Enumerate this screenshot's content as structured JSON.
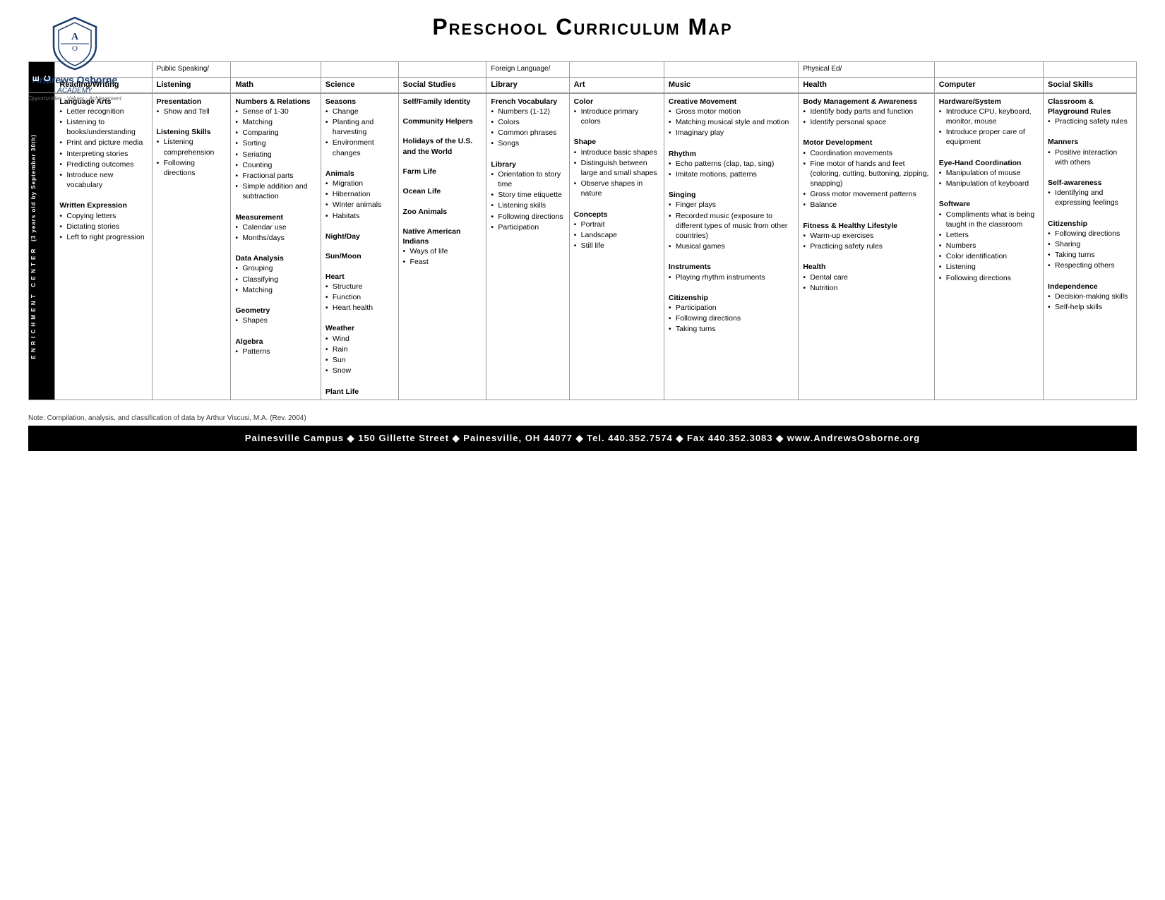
{
  "header": {
    "title": "Preschool Curriculum Map",
    "logo": {
      "school_name_line1": "Andrews Osborne",
      "school_name_line2": "ACADEMY",
      "tagline": "Opportunities · Values · Achievement"
    }
  },
  "table": {
    "ec_label": "E\nC",
    "section_label": "3 years old by September 30th",
    "enrichment_label": "ENRICHMENT CENTER",
    "columns": [
      {
        "super_header": "",
        "header": "Reading/Writing",
        "content_title": "Language Arts",
        "items": [
          "Letter recognition",
          "Listening to books/understanding",
          "Print and picture media",
          "Interpreting stories",
          "Predicting outcomes",
          "Introduce new vocabulary"
        ],
        "sections": [
          {
            "title": "Written Expression",
            "items": [
              "Copying letters",
              "Dictating stories",
              "Left to right progression"
            ]
          }
        ]
      },
      {
        "super_header": "Public Speaking/",
        "header": "Listening",
        "content_title": "Presentation",
        "items": [
          "Show and Tell"
        ],
        "sections": [
          {
            "title": "Listening Skills",
            "items": [
              "Listening comprehension",
              "Following directions"
            ]
          }
        ]
      },
      {
        "super_header": "",
        "header": "Math",
        "content_title": "Numbers & Relations",
        "items": [
          "Sense of 1-30",
          "Matching",
          "Comparing",
          "Sorting",
          "Seriating",
          "Counting",
          "Fractional parts",
          "Simple addition and subtraction"
        ],
        "sections": [
          {
            "title": "Measurement",
            "items": [
              "Calendar use",
              "Months/days"
            ]
          },
          {
            "title": "Data Analysis",
            "items": [
              "Grouping",
              "Classifying",
              "Matching"
            ]
          },
          {
            "title": "Geometry",
            "items": [
              "Shapes"
            ]
          },
          {
            "title": "Algebra",
            "items": [
              "Patterns"
            ]
          }
        ]
      },
      {
        "super_header": "",
        "header": "Science",
        "content_title": "Seasons",
        "items": [
          "Change",
          "Planting and harvesting",
          "Environment changes"
        ],
        "sections": [
          {
            "title": "Animals",
            "items": [
              "Migration",
              "Hibernation",
              "Winter animals",
              "Habitats"
            ]
          },
          {
            "title": "Night/Day",
            "items": []
          },
          {
            "title": "Sun/Moon",
            "items": []
          },
          {
            "title": "Heart",
            "items": [
              "Structure",
              "Function",
              "Heart health"
            ]
          },
          {
            "title": "Weather",
            "items": [
              "Wind",
              "Rain",
              "Sun",
              "Snow"
            ]
          },
          {
            "title": "Plant Life",
            "items": []
          }
        ]
      },
      {
        "super_header": "",
        "header": "Social Studies",
        "content_title": "Self/Family Identity",
        "items": [],
        "sections": [
          {
            "title": "Community Helpers",
            "items": []
          },
          {
            "title": "Holidays of the U.S. and the World",
            "items": []
          },
          {
            "title": "Farm Life",
            "items": []
          },
          {
            "title": "Ocean Life",
            "items": []
          },
          {
            "title": "Zoo Animals",
            "items": []
          },
          {
            "title": "Native American Indians",
            "items": [
              "Ways of life",
              "Feast"
            ]
          }
        ]
      },
      {
        "super_header": "Foreign Language/",
        "header": "Library",
        "content_title": "French Vocabulary",
        "items": [
          "Numbers (1-12)",
          "Colors",
          "Common phrases",
          "Songs"
        ],
        "sections": [
          {
            "title": "Library",
            "items": [
              "Orientation to story time",
              "Story time etiquette",
              "Listening skills",
              "Following directions",
              "Participation"
            ]
          }
        ]
      },
      {
        "super_header": "",
        "header": "Art",
        "content_title": "Color",
        "items": [
          "Introduce primary colors"
        ],
        "sections": [
          {
            "title": "Shape",
            "items": [
              "Introduce basic shapes",
              "Distinguish between large and small shapes",
              "Observe shapes in nature"
            ]
          },
          {
            "title": "Concepts",
            "items": [
              "Portrait",
              "Landscape",
              "Still life"
            ]
          }
        ]
      },
      {
        "super_header": "",
        "header": "Music",
        "content_title": "Creative Movement",
        "items": [
          "Gross motor motion",
          "Matching musical style and motion",
          "Imaginary play"
        ],
        "sections": [
          {
            "title": "Rhythm",
            "items": [
              "Echo patterns (clap, tap, sing)",
              "Imitate motions, patterns"
            ]
          },
          {
            "title": "Singing",
            "items": [
              "Finger plays",
              "Recorded music (exposure to different types of music from other countries)",
              "Musical games"
            ]
          },
          {
            "title": "Instruments",
            "items": [
              "Playing rhythm instruments"
            ]
          },
          {
            "title": "Citizenship",
            "items": [
              "Participation",
              "Following directions",
              "Taking turns"
            ]
          }
        ]
      },
      {
        "super_header": "Physical Ed/",
        "header": "Health",
        "content_title": "Body Management & Awareness",
        "items": [
          "Identify body parts and function",
          "Identify personal space"
        ],
        "sections": [
          {
            "title": "Motor Development",
            "items": [
              "Coordination movements",
              "Fine motor of hands and feet (coloring, cutting, buttoning, zipping, snapping)",
              "Gross motor movement patterns",
              "Balance"
            ]
          },
          {
            "title": "Fitness & Healthy Lifestyle",
            "items": [
              "Warm-up exercises",
              "Practicing safety rules"
            ]
          },
          {
            "title": "Health",
            "items": [
              "Dental care",
              "Nutrition"
            ]
          }
        ]
      },
      {
        "super_header": "",
        "header": "Computer",
        "content_title": "Hardware/System",
        "items": [
          "Introduce CPU, keyboard, monitor, mouse",
          "Introduce proper care of equipment"
        ],
        "sections": [
          {
            "title": "Eye-Hand Coordination",
            "items": [
              "Manipulation of mouse",
              "Manipulation of keyboard"
            ]
          },
          {
            "title": "Software",
            "items": [
              "Compliments what is being taught in the classroom",
              "Letters",
              "Numbers",
              "Color identification",
              "Listening",
              "Following directions"
            ]
          }
        ]
      },
      {
        "super_header": "",
        "header": "Social Skills",
        "content_title": "Classroom & Playground Rules",
        "items": [
          "Practicing safety rules"
        ],
        "sections": [
          {
            "title": "Manners",
            "items": [
              "Positive interaction with others"
            ]
          },
          {
            "title": "Self-awareness",
            "items": [
              "Identifying and expressing feelings"
            ]
          },
          {
            "title": "Citizenship",
            "items": [
              "Following directions",
              "Sharing",
              "Taking turns",
              "Respecting others"
            ]
          },
          {
            "title": "Independence",
            "items": [
              "Decision-making skills",
              "Self-help skills"
            ]
          }
        ]
      }
    ]
  },
  "footer": {
    "note": "Note: Compilation, analysis, and classification of data by Arthur Viscusi, M.A. (Rev. 2004)",
    "address_line": "Painesville Campus  ◆  150 Gillette Street  ◆  Painesville, OH 44077  ◆  Tel. 440.352.7574  ◆  Fax 440.352.3083  ◆  www.AndrewsOsborne.org"
  }
}
